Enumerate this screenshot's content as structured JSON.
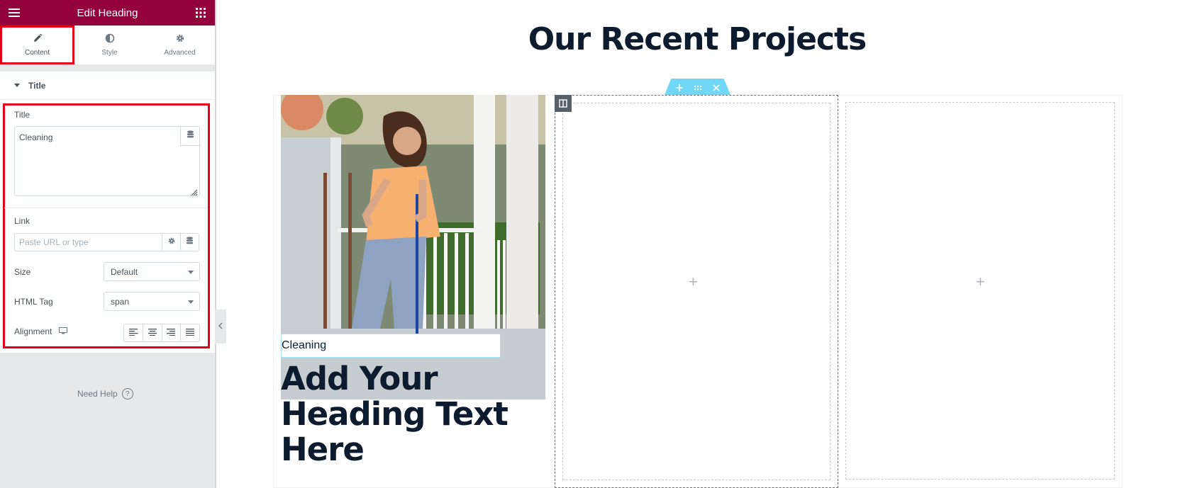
{
  "header": {
    "title": "Edit Heading"
  },
  "tabs": [
    {
      "label": "Content",
      "icon": "pencil-icon",
      "active": true
    },
    {
      "label": "Style",
      "icon": "half-circle-icon",
      "active": false
    },
    {
      "label": "Advanced",
      "icon": "gear-icon",
      "active": false
    }
  ],
  "section": {
    "title": "Title"
  },
  "controls": {
    "title_label": "Title",
    "title_value": "Cleaning",
    "link_label": "Link",
    "link_placeholder": "Paste URL or type",
    "size_label": "Size",
    "size_value": "Default",
    "html_tag_label": "HTML Tag",
    "html_tag_value": "span",
    "alignment_label": "Alignment"
  },
  "footer": {
    "need_help": "Need Help"
  },
  "canvas": {
    "page_title": "Our Recent Projects",
    "caption": "Cleaning",
    "heading": "Add Your Heading Text Here"
  },
  "colors": {
    "brand": "#93003c",
    "highlight": "#e2001a",
    "handle": "#71d7f7",
    "heading_text": "#0c1c2e"
  }
}
